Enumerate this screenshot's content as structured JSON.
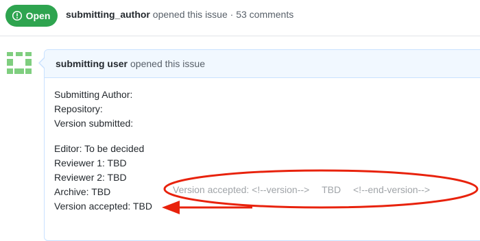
{
  "issue": {
    "state_label": "Open",
    "author": "submitting_author",
    "opened_text": "opened this issue",
    "separator": "·",
    "comments": "53 comments"
  },
  "comment": {
    "user": "submitting user",
    "action": "opened this issue",
    "lines": {
      "submitting_author": "Submitting Author:",
      "repository": "Repository:",
      "version_submitted": "Version submitted:",
      "editor": "Editor: To be decided",
      "reviewer1": "Reviewer 1: TBD",
      "reviewer2": "Reviewer 2: TBD",
      "archive": "Archive: TBD",
      "version_accepted": "Version accepted: TBD"
    },
    "hidden_source": {
      "label": "Version accepted: <!--version-->",
      "value": "TBD",
      "end_marker": "<!--end-version-->"
    }
  },
  "colors": {
    "open_green": "#2ea44f",
    "annotation_red": "#e8220c",
    "comment_header_bg": "#f1f8ff",
    "comment_border": "#c8e1ff",
    "avatar_green": "#7fce7f"
  },
  "icons": {
    "state": "issue-opened-icon",
    "avatar": "identicon-avatar",
    "annotation": "red-ellipse-and-arrow"
  }
}
